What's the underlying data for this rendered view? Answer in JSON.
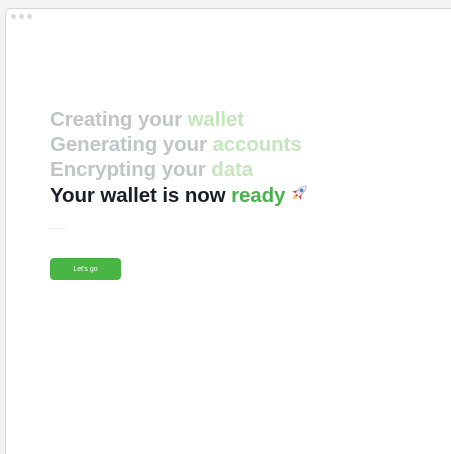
{
  "window": {
    "controls": [
      "close",
      "minimize",
      "maximize"
    ]
  },
  "progress": {
    "steps": [
      {
        "prefix": "Creating your ",
        "accent": "wallet",
        "state": "pending"
      },
      {
        "prefix": "Generating your ",
        "accent": "accounts",
        "state": "pending"
      },
      {
        "prefix": "Encrypting your ",
        "accent": "data",
        "state": "pending"
      },
      {
        "prefix": "Your wallet is now ",
        "accent": "ready",
        "state": "done",
        "icon": "rocket-icon"
      }
    ]
  },
  "actions": {
    "go_label": "Let's go"
  },
  "colors": {
    "pending_text": "#c3c4c8",
    "pending_accent": "#c4e6bd",
    "done_text": "#1c1c2a",
    "done_accent": "#48b34a",
    "button": "#49b544"
  }
}
